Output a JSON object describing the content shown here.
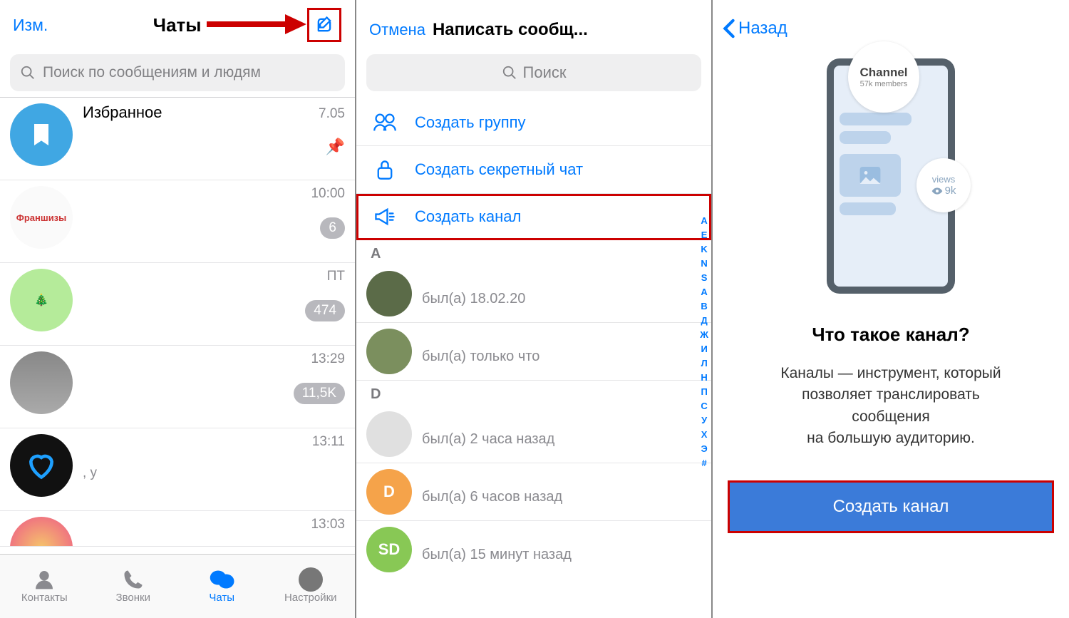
{
  "panel1": {
    "edit_label": "Изм.",
    "title": "Чаты",
    "search_placeholder": "Поиск по сообщениям и людям",
    "chats": [
      {
        "name": "Избранное",
        "time": "7.05",
        "badge": "",
        "pinned": true,
        "avatar_color": "#40a7e3"
      },
      {
        "name": "Франшизы",
        "time": "10:00",
        "badge": "6",
        "pinned": false,
        "avatar_label": "Франшизы"
      },
      {
        "name": "",
        "time": "ПТ",
        "badge": "474",
        "pinned": false,
        "avatar_color": "#a2e07a"
      },
      {
        "name": "",
        "time": "13:29",
        "badge": "11,5K",
        "pinned": false,
        "avatar_color": "#9d9d9d"
      },
      {
        "name": "",
        "time": "13:11",
        "badge": "",
        "sub": ", у",
        "pinned": false,
        "avatar_color": "#111"
      },
      {
        "name": "",
        "time": "13:03",
        "badge": "",
        "pinned": false,
        "avatar_color": "#f5c56b"
      }
    ],
    "tabs": [
      {
        "label": "Контакты",
        "icon": "person"
      },
      {
        "label": "Звонки",
        "icon": "phone"
      },
      {
        "label": "Чаты",
        "icon": "chat",
        "active": true
      },
      {
        "label": "Настройки",
        "icon": "settings"
      }
    ]
  },
  "panel2": {
    "cancel_label": "Отмена",
    "title": "Написать сообщ...",
    "search_label": "Поиск",
    "actions": [
      {
        "label": "Создать группу",
        "icon": "group"
      },
      {
        "label": "Создать секретный чат",
        "icon": "lock"
      },
      {
        "label": "Создать канал",
        "icon": "megaphone",
        "highlight": true
      }
    ],
    "section_a": "A",
    "section_d": "D",
    "contacts": [
      {
        "status": "был(а) 18.02.20",
        "avatar_color": "#5b6b48"
      },
      {
        "status": "был(а) только что",
        "avatar_color": "#7b8f5e"
      },
      {
        "status": "был(а) 2 часа назад",
        "avatar_color": "#e0e0e0",
        "section": "D"
      },
      {
        "status": "был(а) 6 часов назад",
        "avatar_color": "#f5a34a",
        "initial": "D"
      },
      {
        "status": "был(а) 15 минут назад",
        "avatar_color": "#88c855",
        "initial": "SD"
      }
    ],
    "index": [
      "A",
      "E",
      "K",
      "N",
      "S",
      "А",
      "В",
      "Д",
      "Ж",
      "И",
      "Л",
      "Н",
      "П",
      "С",
      "У",
      "Х",
      "Э",
      "#"
    ]
  },
  "panel3": {
    "back_label": "Назад",
    "badge_channel": "Channel",
    "badge_members": "57k members",
    "badge_views_label": "views",
    "badge_views_count": "9k",
    "heading": "Что такое канал?",
    "desc_line1": "Каналы — инструмент, который",
    "desc_line2": "позволяет транслировать",
    "desc_line3": "сообщения",
    "desc_line4": "на большую аудиторию.",
    "button_label": "Создать канал"
  }
}
